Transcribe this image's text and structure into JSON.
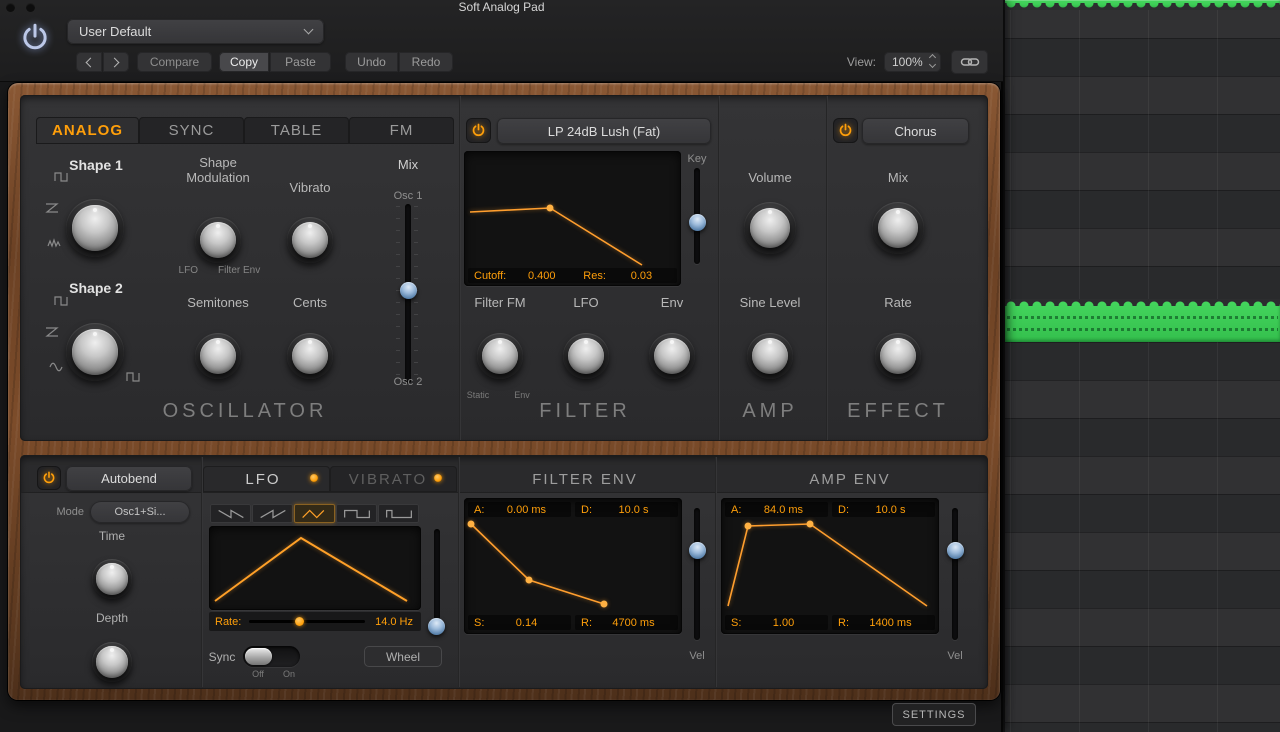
{
  "header": {
    "title": "Soft Analog Pad",
    "preset": "User Default",
    "compare": "Compare",
    "copy": "Copy",
    "paste": "Paste",
    "undo": "Undo",
    "redo": "Redo",
    "view_label": "View:",
    "view_value": "100%"
  },
  "osc_tabs": {
    "analog": "ANALOG",
    "sync": "SYNC",
    "table": "TABLE",
    "fm": "FM"
  },
  "oscillator": {
    "title": "OSCILLATOR",
    "shape1": "Shape 1",
    "shape2": "Shape 2",
    "shape_mod_line1": "Shape",
    "shape_mod_line2": "Modulation",
    "sub_lfo": "LFO",
    "sub_filter_env": "Filter Env",
    "vibrato": "Vibrato",
    "semitones": "Semitones",
    "cents": "Cents",
    "mix": "Mix",
    "osc1": "Osc 1",
    "osc2": "Osc 2"
  },
  "filter": {
    "title": "FILTER",
    "preset": "LP 24dB Lush (Fat)",
    "cutoff_label": "Cutoff:",
    "cutoff_value": "0.400",
    "res_label": "Res:",
    "res_value": "0.03",
    "key_label": "Key",
    "filter_fm": "Filter FM",
    "sub_static": "Static",
    "sub_env": "Env",
    "lfo": "LFO",
    "env": "Env"
  },
  "amp": {
    "title": "AMP",
    "volume": "Volume",
    "sine_level": "Sine Level"
  },
  "effect": {
    "title": "EFFECT",
    "preset": "Chorus",
    "mix": "Mix",
    "rate": "Rate"
  },
  "autobend": {
    "label": "Autobend",
    "mode_label": "Mode",
    "mode_value": "Osc1+Si...",
    "time": "Time",
    "depth": "Depth"
  },
  "lfo_panel": {
    "lfo_tab": "LFO",
    "vibrato_tab": "VIBRATO",
    "rate_label": "Rate:",
    "rate_value": "14.0 Hz",
    "sync_label": "Sync",
    "off": "Off",
    "on": "On",
    "wheel": "Wheel"
  },
  "filter_env": {
    "title": "FILTER ENV",
    "a_label": "A:",
    "a_value": "0.00 ms",
    "d_label": "D:",
    "d_value": "10.0 s",
    "s_label": "S:",
    "s_value": "0.14",
    "r_label": "R:",
    "r_value": "4700 ms",
    "vel_label": "Vel"
  },
  "amp_env": {
    "title": "AMP ENV",
    "a_label": "A:",
    "a_value": "84.0 ms",
    "d_label": "D:",
    "d_value": "10.0 s",
    "s_label": "S:",
    "s_value": "1.00",
    "r_label": "R:",
    "r_value": "1400 ms",
    "vel_label": "Vel"
  },
  "settings_label": "SETTINGS",
  "icons": {
    "power": "power-ring-glyph",
    "chevron_down": "css-chevron",
    "nav_back": "chevron-left",
    "nav_forward": "chevron-right",
    "view_stepper": "up-down-chevrons",
    "link": "chain-links",
    "wave_saw_down": "saw-down-wave",
    "wave_saw_up": "saw-up-wave",
    "wave_triangle": "triangle-wave",
    "wave_square": "square-wave",
    "wave_pulse": "pulse-wave"
  },
  "colors": {
    "accent_orange": "#ff9f0a",
    "midi_green": "#3ed45c",
    "slider_blue": "#7aa0cc",
    "wood": "#754526"
  }
}
